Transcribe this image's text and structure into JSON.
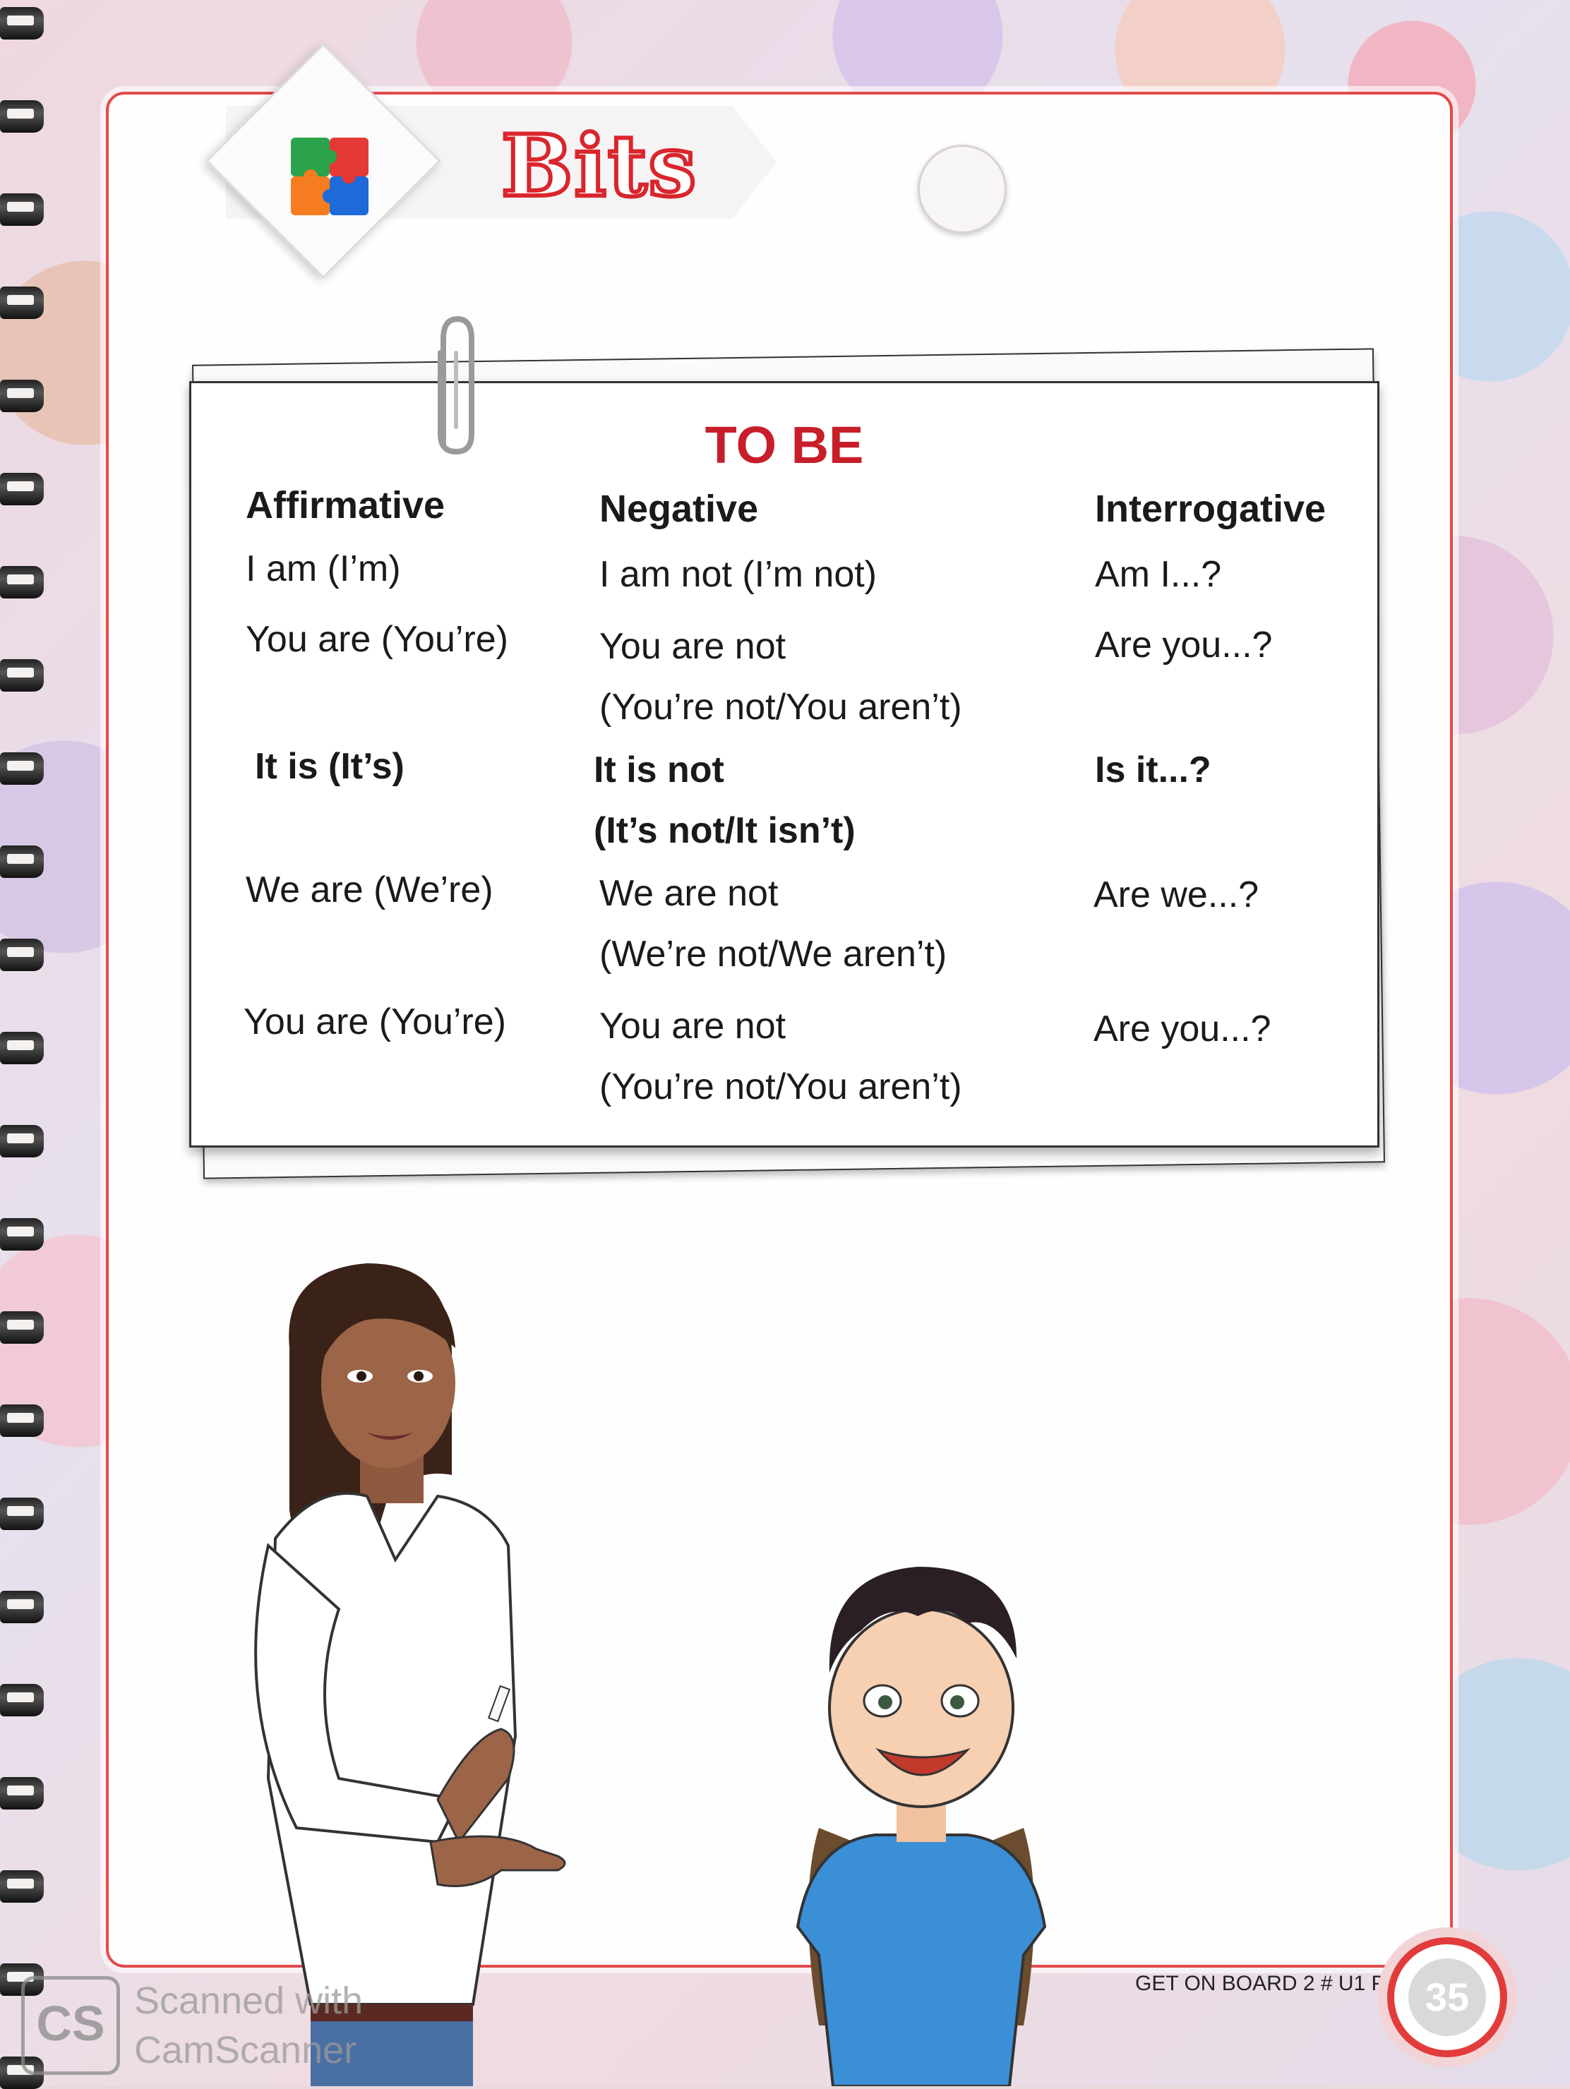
{
  "header": {
    "title": "Bits"
  },
  "table": {
    "title": "TO BE",
    "columns": [
      "Affirmative",
      "Negative",
      "Interrogative"
    ],
    "rows": [
      {
        "affirmative": "I am (I’m)",
        "negative": [
          "I am not (I’m not)"
        ],
        "interrogative": "Am I...?"
      },
      {
        "affirmative": "You are (You’re)",
        "negative": [
          "You are not",
          "(You’re not/You aren’t)"
        ],
        "interrogative": "Are you...?"
      },
      {
        "affirmative": "It is (It’s)",
        "negative": [
          "It is not",
          "(It’s not/It isn’t)"
        ],
        "interrogative": "Is it...?"
      },
      {
        "affirmative": "We are (We’re)",
        "negative": [
          "We are not",
          "(We’re not/We aren’t)"
        ],
        "interrogative": "Are we...?"
      },
      {
        "affirmative": "You are (You’re)",
        "negative": [
          "You are not",
          "(You’re not/You aren’t)"
        ],
        "interrogative": "Are you...?"
      }
    ]
  },
  "footer": {
    "book_ref": "GET ON BOARD 2 # U1 PC",
    "page_number": "35"
  },
  "watermark": {
    "logo": "CS",
    "text": "Scanned with\nCamScanner"
  },
  "colors": {
    "accent_red": "#c81e2a",
    "border_red": "#e24b4b"
  }
}
